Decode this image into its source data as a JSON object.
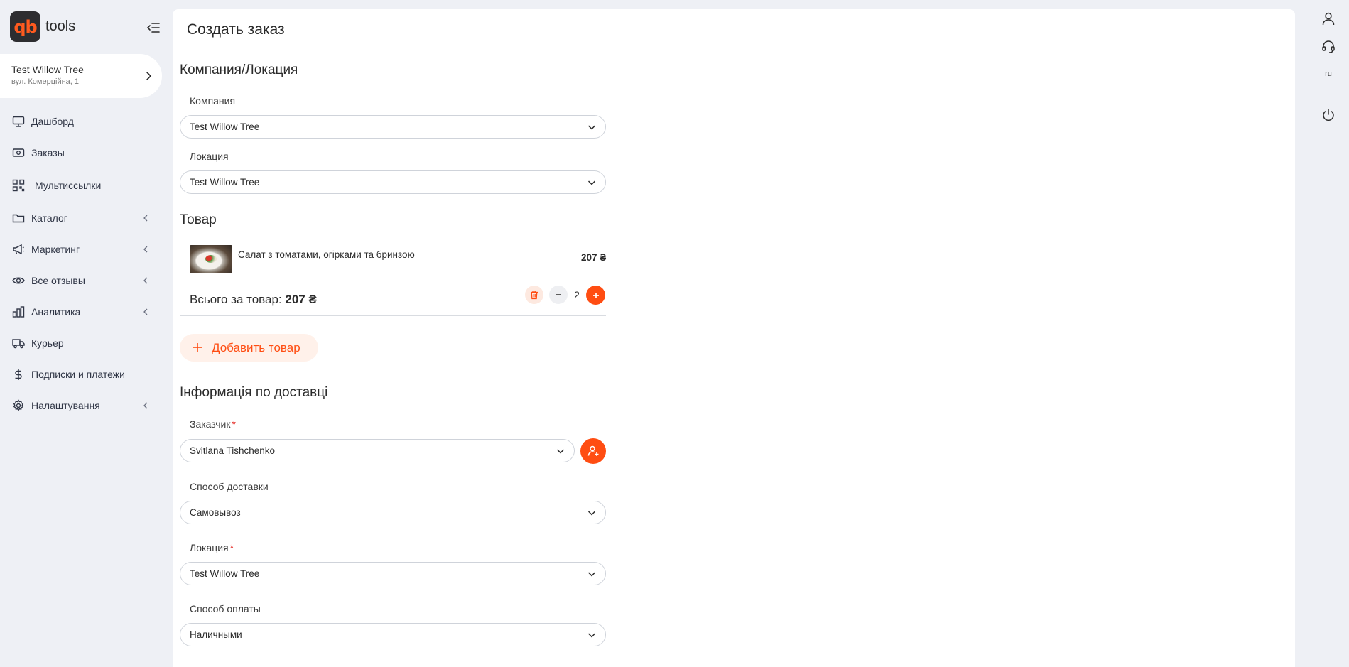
{
  "app": {
    "logo_mark": "qb",
    "logo_text": "tools"
  },
  "company_card": {
    "name": "Test Willow Tree",
    "address": "вул. Комерційна, 1"
  },
  "sidebar": {
    "items": [
      {
        "label": "Дашборд",
        "icon": "monitor-icon",
        "has_submenu": false
      },
      {
        "label": "Заказы",
        "icon": "banknote-icon",
        "has_submenu": false
      },
      {
        "label": "Мультиссылки",
        "icon": "qr-code-icon",
        "has_submenu": false
      },
      {
        "label": "Каталог",
        "icon": "folder-icon",
        "has_submenu": true
      },
      {
        "label": "Маркетинг",
        "icon": "megaphone-icon",
        "has_submenu": true
      },
      {
        "label": "Все отзывы",
        "icon": "eye-icon",
        "has_submenu": true
      },
      {
        "label": "Аналитика",
        "icon": "bar-chart-icon",
        "has_submenu": true
      },
      {
        "label": "Курьер",
        "icon": "truck-icon",
        "has_submenu": false
      },
      {
        "label": "Подписки и платежи",
        "icon": "dollar-icon",
        "has_submenu": false
      },
      {
        "label": "Налаштування",
        "icon": "gear-icon",
        "has_submenu": true
      }
    ]
  },
  "page": {
    "title": "Создать заказ"
  },
  "company_section": {
    "title": "Компания/Локация",
    "company_label": "Компания",
    "company_value": "Test Willow Tree",
    "location_label": "Локация",
    "location_value": "Test Willow Tree"
  },
  "product_section": {
    "title": "Товар",
    "product_name": "Салат з томатами, огірками та бринзою",
    "product_price": "207 ₴",
    "total_label": "Всього за товар:",
    "total_value": "207 ₴",
    "quantity": "2",
    "add_button": "Добавить товар"
  },
  "delivery_section": {
    "title": "Інформація по доставці",
    "customer_label": "Заказчик",
    "customer_value": "Svitlana Tishchenko",
    "delivery_label": "Способ доставки",
    "delivery_value": "Самовывоз",
    "location_label": "Локация",
    "location_value": "Test Willow Tree",
    "payment_label": "Способ оплаты",
    "payment_value": "Наличными",
    "required_mark": "*"
  },
  "right_rail": {
    "language": "ru"
  },
  "colors": {
    "accent": "#ff4d12",
    "background": "#eef0f5",
    "required": "#e5302b"
  }
}
